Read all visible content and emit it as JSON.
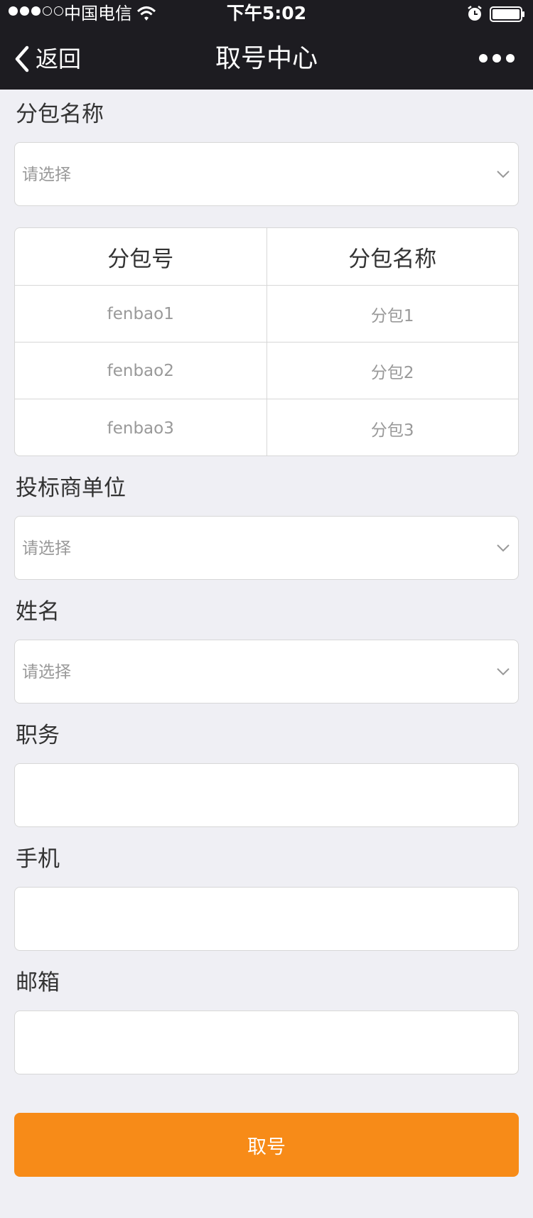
{
  "status_bar": {
    "carrier": "中国电信",
    "time": "下午5:02"
  },
  "nav": {
    "back_label": "返回",
    "title": "取号中心"
  },
  "form": {
    "package_name": {
      "label": "分包名称",
      "placeholder": "请选择"
    },
    "package_table": {
      "headers": [
        "分包号",
        "分包名称"
      ],
      "rows": [
        [
          "fenbao1",
          "分包1"
        ],
        [
          "fenbao2",
          "分包2"
        ],
        [
          "fenbao3",
          "分包3"
        ]
      ]
    },
    "bidder_unit": {
      "label": "投标商单位",
      "placeholder": "请选择"
    },
    "name": {
      "label": "姓名",
      "placeholder": "请选择"
    },
    "position": {
      "label": "职务",
      "value": ""
    },
    "phone": {
      "label": "手机",
      "value": ""
    },
    "email": {
      "label": "邮箱",
      "value": ""
    },
    "submit_label": "取号"
  },
  "colors": {
    "nav_bg": "#1d1c21",
    "page_bg": "#efeff4",
    "accent": "#f78b18"
  }
}
